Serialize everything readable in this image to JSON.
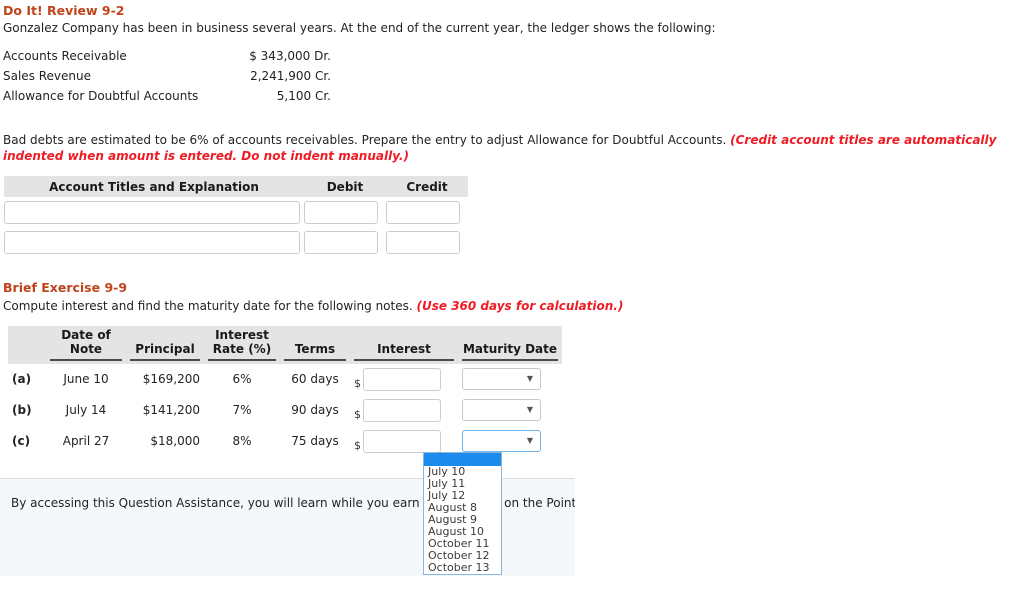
{
  "doit": {
    "title": "Do It! Review 9-2",
    "intro": "Gonzalez Company has been in business several years. At the end of the current year, the ledger shows the following:",
    "ledger": [
      {
        "account": "Accounts Receivable",
        "amount": "$ 343,000 Dr."
      },
      {
        "account": "Sales Revenue",
        "amount": "2,241,900 Cr."
      },
      {
        "account": "Allowance for Doubtful Accounts",
        "amount": "5,100 Cr."
      }
    ],
    "instruction_plain": "Bad debts are estimated to be 6% of accounts receivables. Prepare the entry to adjust Allowance for Doubtful Accounts. ",
    "instruction_emphasis": "(Credit account titles are automatically indented when amount is entered. Do not indent manually.)"
  },
  "journal": {
    "headers": {
      "account": "Account Titles and Explanation",
      "debit": "Debit",
      "credit": "Credit"
    },
    "rows": [
      {
        "account": "",
        "debit": "",
        "credit": ""
      },
      {
        "account": "",
        "debit": "",
        "credit": ""
      }
    ]
  },
  "brief_exercise": {
    "title": "Brief Exercise 9-9",
    "intro_plain": "Compute interest and find the maturity date for the following notes. ",
    "intro_emphasis": "(Use 360 days for calculation.)",
    "headers": {
      "label": "",
      "date_of_note": "Date of\nNote",
      "date_of_note_line1": "Date of",
      "date_of_note_line2": "Note",
      "principal": "Principal",
      "interest_rate": "Interest\nRate (%)",
      "interest_rate_line1": "Interest",
      "interest_rate_line2": "Rate (%)",
      "terms": "Terms",
      "interest": "Interest",
      "maturity_date": "Maturity Date"
    },
    "rows": [
      {
        "label": "(a)",
        "date_of_note": "June 10",
        "principal": "$169,200",
        "interest_rate": "6%",
        "terms": "60 days",
        "interest_prefix": "$",
        "interest_value": "",
        "maturity_value": ""
      },
      {
        "label": "(b)",
        "date_of_note": "July 14",
        "principal": "$141,200",
        "interest_rate": "7%",
        "terms": "90 days",
        "interest_prefix": "$",
        "interest_value": "",
        "maturity_value": ""
      },
      {
        "label": "(c)",
        "date_of_note": "April 27",
        "principal": "$18,000",
        "interest_rate": "8%",
        "terms": "75 days",
        "interest_prefix": "$",
        "interest_value": "",
        "maturity_value": ""
      }
    ]
  },
  "maturity_dropdown": {
    "open": true,
    "selected": "",
    "options": [
      "",
      "July 10",
      "July 11",
      "July 12",
      "August 8",
      "August 9",
      "August 10",
      "October 11",
      "October 12",
      "October 13"
    ]
  },
  "question_assistance": {
    "text": "By accessing this Question Assistance, you will learn while you earn points based on the Point Potential Policy set by your instructor."
  },
  "icons": {
    "caret_down": "▼"
  },
  "colors": {
    "heading": "#c0441a",
    "emphasis": "#ee1c25",
    "table_header_bg": "#e4e4e4",
    "select_highlight": "#1b8ced",
    "panel_bg": "#f4f8fb"
  }
}
